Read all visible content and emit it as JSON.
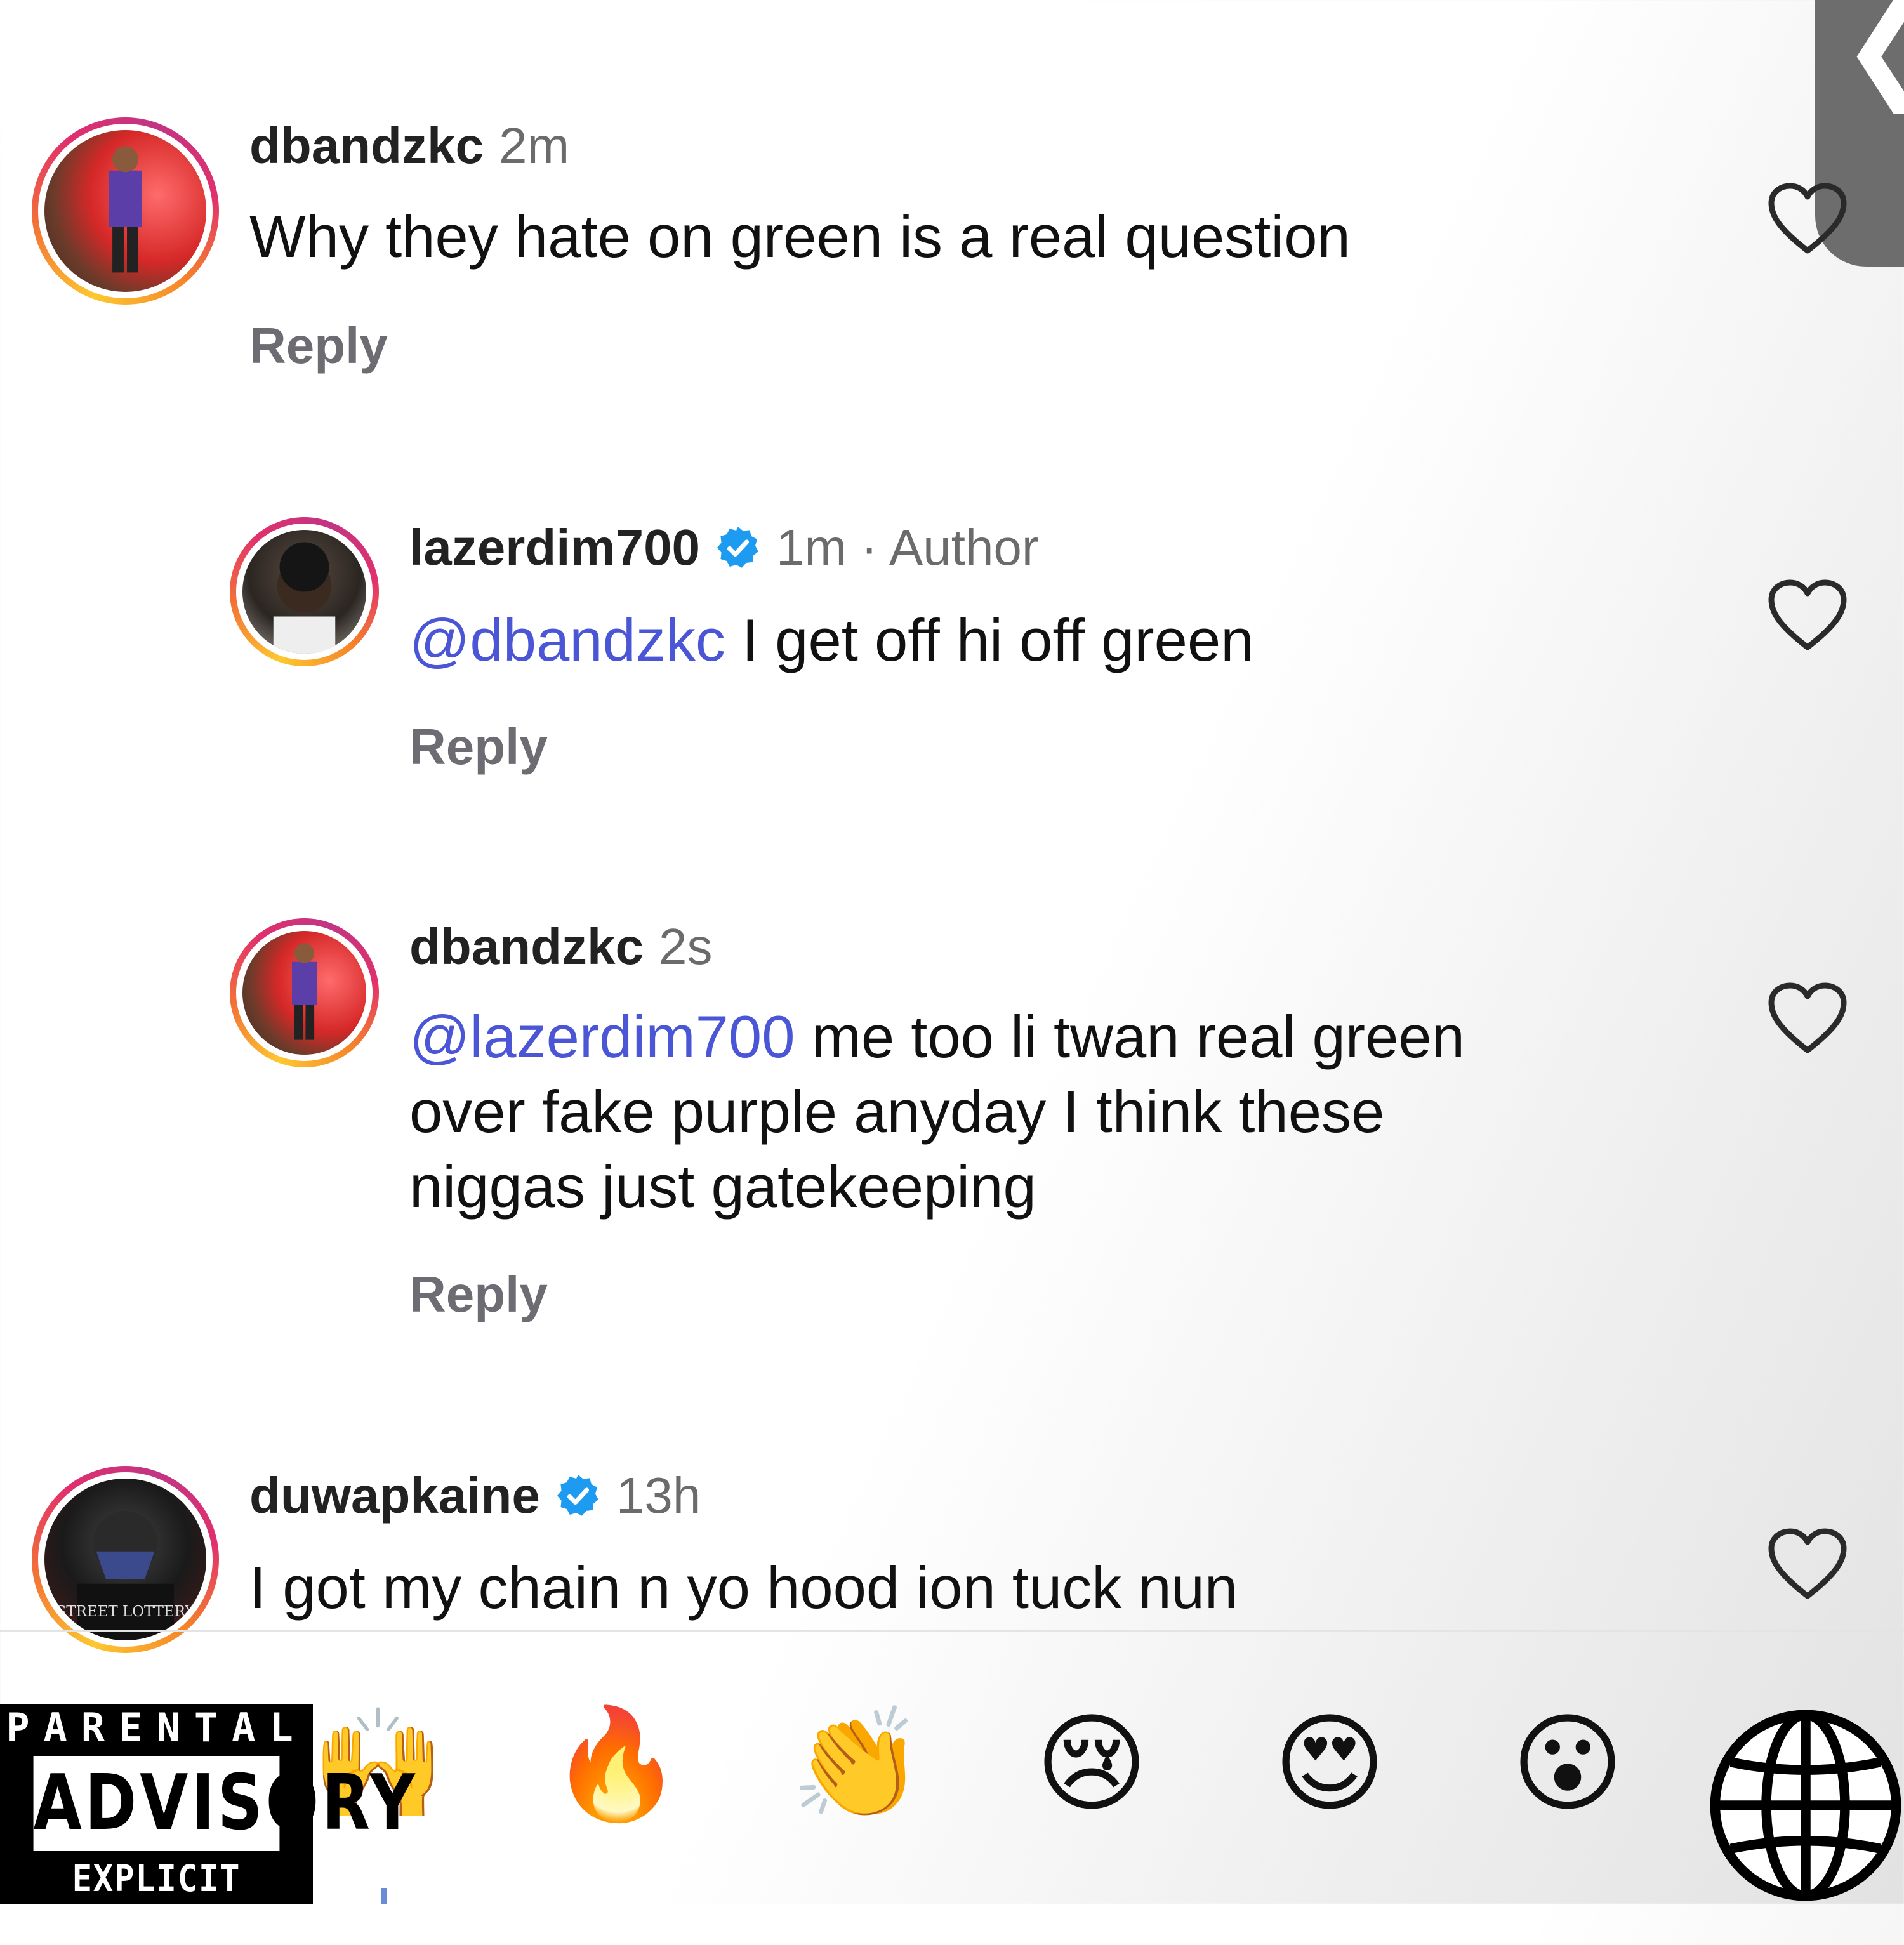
{
  "comments": [
    {
      "username": "dbandzkc",
      "meta": "2m",
      "verified": false,
      "text": "Why they hate on green is a real question",
      "reply": "Reply",
      "level": 0
    },
    {
      "username": "lazerdim700",
      "meta": "1m · Author",
      "verified": true,
      "mention": "@dbandzkc",
      "text": " I get off hi off green",
      "reply": "Reply",
      "level": 1
    },
    {
      "username": "dbandzkc",
      "meta": "2s",
      "verified": false,
      "mention": "@lazerdim700",
      "text_line1": " me too li twan real green",
      "text_line2": "over fake purple anyday I think these",
      "text_line3": "niggas just gatekeeping",
      "reply": "Reply",
      "level": 1
    },
    {
      "username": "duwapkaine",
      "meta": "13h",
      "verified": true,
      "text": "I got my chain n yo hood ion tuck nun",
      "level": 0,
      "avatar_text": "STREET LOTTERY"
    }
  ],
  "emoji_bar": [
    "🙌",
    "🔥",
    "👏",
    "😢",
    "😍",
    "😮"
  ],
  "advisory": {
    "line1": "PARENTAL",
    "line2": "ADVISORY",
    "line3": "EXPLICIT CONTENT"
  },
  "scroll_tab_glyph": "❮",
  "colors": {
    "mention": "#4a56d6",
    "verified": "#1d9bf0",
    "meta": "#6b6b6b"
  },
  "icons": [
    "heart-icon",
    "verified-badge-icon",
    "globe-icon",
    "chevron-left-icon"
  ]
}
